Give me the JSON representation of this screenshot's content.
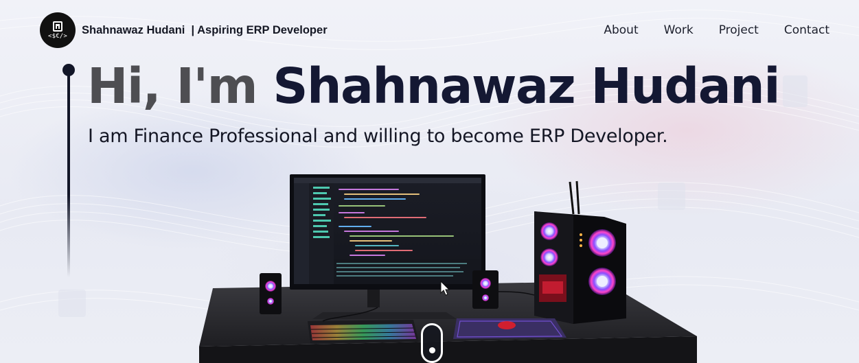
{
  "header": {
    "logo_text": "<$€/>",
    "brand_title": "Shahnawaz Hudani  | Aspiring ERP Developer",
    "nav": [
      "About",
      "Work",
      "Project",
      "Contact"
    ]
  },
  "hero": {
    "greeting": "Hi, I'm ",
    "name": "Shahnawaz Hudani",
    "subtitle": "I am Finance Professional and willing to become ERP Developer."
  },
  "colors": {
    "primary_dark": "#121628",
    "greeting_gray": "#4e4e52",
    "background": "#eef0f6"
  },
  "icons": {
    "logo": "calculator-code-icon",
    "scroll": "mouse-scroll-icon"
  }
}
